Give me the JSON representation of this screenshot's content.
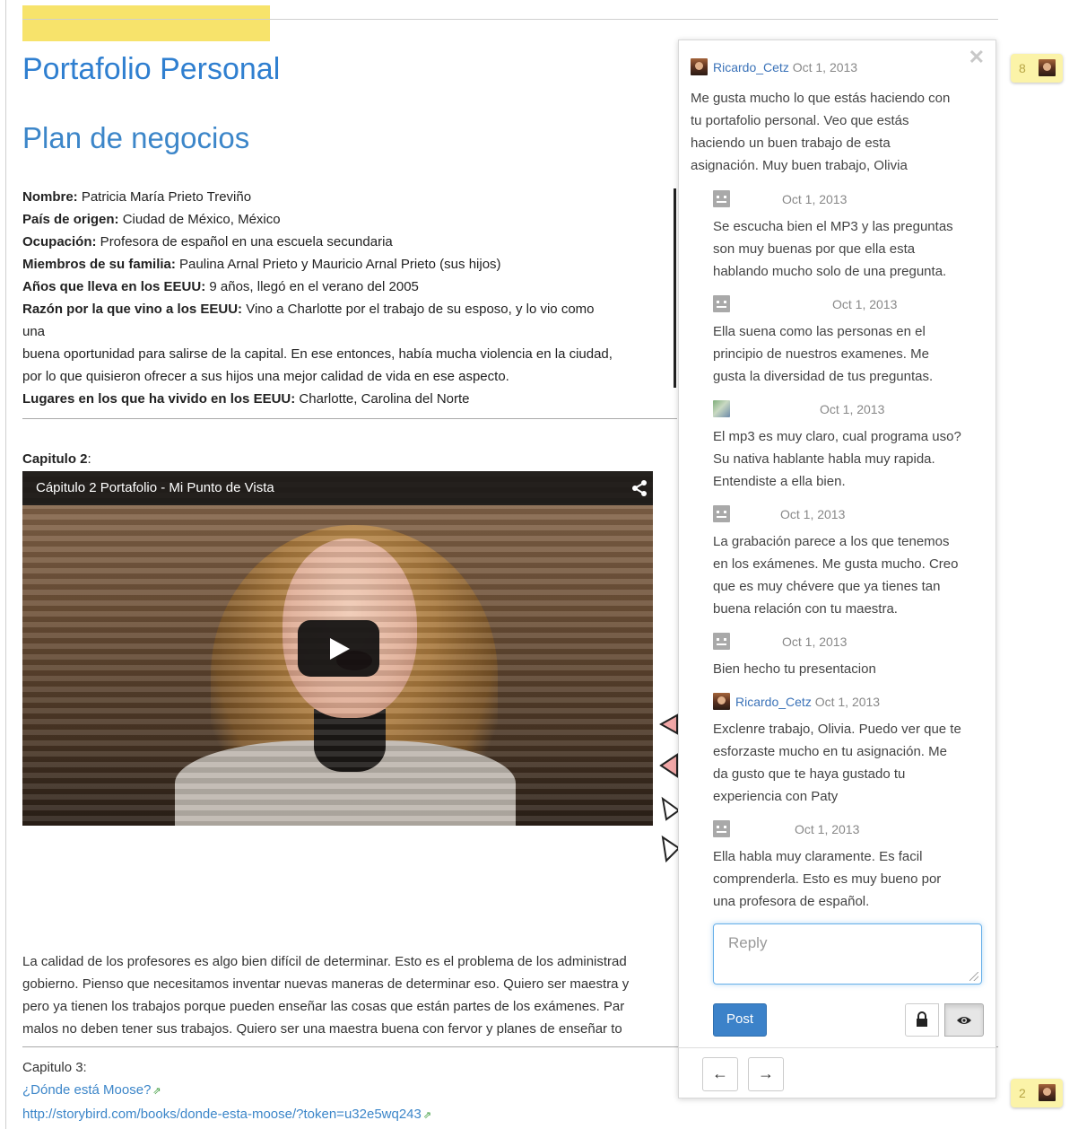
{
  "page": {
    "title": "Portafolio Personal",
    "subtitle": "Plan de negocios",
    "info": [
      {
        "label": "Nombre:",
        "value": " Patricia María Prieto Treviño"
      },
      {
        "label": "País de origen:",
        "value": " Ciudad de México, México"
      },
      {
        "label": "Ocupación:",
        "value": " Profesora de español en una escuela secundaria"
      },
      {
        "label": "Miembros de su familia:",
        "value": " Paulina Arnal Prieto y Mauricio Arnal Prieto (sus hijos)"
      },
      {
        "label": "Años que lleva en los EEUU:",
        "value": " 9 años, llegó en el verano del 2005"
      },
      {
        "label": "Razón por la que vino a los EEUU:",
        "value": " Vino a Charlotte por el trabajo de su esposo, y lo vio como"
      }
    ],
    "info_continuation": [
      "una",
      "buena oportunidad para salirse de la capital. En ese entonces, había mucha violencia en la ciudad,",
      "por lo que quisieron ofrecer a sus hijos una mejor calidad de vida en ese aspecto."
    ],
    "info_last": {
      "label": "Lugares en los que ha vivido en los EEUU:",
      "value": " Charlotte, Carolina del Norte"
    },
    "chapter2_label": "Capitulo 2",
    "chapter2_colon": ":",
    "video_title": "Cápitulo 2 Portafolio - Mi Punto de Vista",
    "paragraph": [
      "La calidad de los profesores es algo bien difícil de determinar. Esto es el problema de los administrad",
      "gobierno. Pienso que necesitamos inventar nuevas maneras de determinar eso. Quiero ser maestra y",
      "pero ya tienen los trabajos porque pueden enseñar las cosas que están partes de los exámenes. Par",
      "malos no deben tener sus trabajos. Quiero ser una maestra buena con fervor y planes de enseñar to"
    ],
    "chapter3_label": "Capitulo 3:",
    "chapter3_link": "¿Dónde está Moose?",
    "chapter3_url": "http://storybird.com/books/donde-esta-moose/?token=u32e5wq243"
  },
  "comments": [
    {
      "user": "Ricardo_Cetz",
      "date": "Oct 1, 2013",
      "avatar": "photo",
      "lines": [
        "Me gusta mucho lo que estás haciendo con",
        "tu portafolio personal. Veo que estás",
        "haciendo un buen trabajo de esta",
        "asignación. Muy buen trabajo, Olivia"
      ]
    },
    {
      "user": "",
      "date": "Oct 1, 2013",
      "avatar": "anon",
      "lines": [
        "Se escucha bien el MP3 y las preguntas",
        "son muy buenas por que ella esta",
        "hablando mucho solo de una pregunta."
      ]
    },
    {
      "user": "",
      "date": "Oct 1, 2013",
      "avatar": "anon",
      "lines": [
        "Ella suena como las personas en el",
        "principio de nuestros examenes. Me",
        "gusta la diversidad de tus preguntas."
      ]
    },
    {
      "user": "",
      "date": "Oct 1, 2013",
      "avatar": "landscape",
      "lines": [
        "El mp3 es muy claro, cual programa uso?",
        "Su nativa hablante habla muy rapida.",
        "Entendiste a ella bien."
      ]
    },
    {
      "user": "",
      "date": "Oct 1, 2013",
      "avatar": "anon",
      "lines": [
        "La grabación parece a los que tenemos",
        "en los exámenes. Me gusta mucho. Creo",
        "que es muy chévere que ya tienes tan",
        "buena relación con tu maestra."
      ]
    },
    {
      "user": "",
      "date": "Oct 1, 2013",
      "avatar": "anon",
      "lines": [
        "Bien hecho tu presentacion"
      ]
    },
    {
      "user": "Ricardo_Cetz",
      "date": "Oct 1, 2013",
      "avatar": "photo",
      "lines": [
        "Exclenre trabajo, Olivia. Puedo ver que te",
        "esforzaste mucho en tu asignación. Me",
        "da gusto que te haya gustado tu",
        "experiencia con Paty"
      ]
    },
    {
      "user": "",
      "date": "Oct 1, 2013",
      "avatar": "anon",
      "lines": [
        "Ella habla muy claramente. Es facil",
        "comprenderla. Esto es muy bueno por",
        "una profesora de español."
      ]
    }
  ],
  "reply": {
    "placeholder": "Reply",
    "post_label": "Post"
  },
  "badges": [
    {
      "count": "8"
    },
    {
      "count": "2"
    }
  ],
  "icons": {
    "close": "close-icon",
    "lock": "lock-icon",
    "eye": "eye-icon",
    "share": "share-icon",
    "play": "play-icon",
    "prev": "arrow-left-icon",
    "next": "arrow-right-icon"
  },
  "colors": {
    "link": "#3c86c9",
    "post_button": "#3c82c9",
    "highlight": "#f7e36b",
    "badge": "#fbf3a8"
  }
}
